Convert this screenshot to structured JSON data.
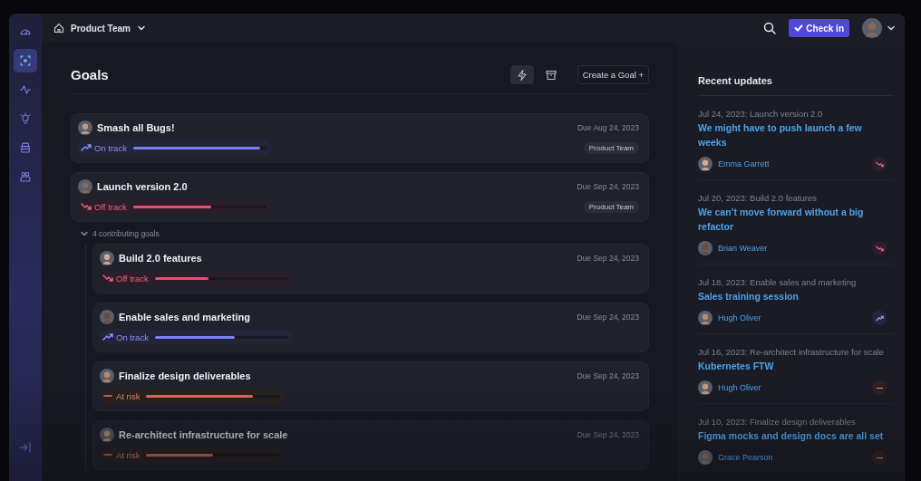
{
  "topbar": {
    "team": "Product Team",
    "check_in": "Check in"
  },
  "sidebar": {
    "items": [
      {
        "selected": false
      },
      {
        "selected": true
      },
      {
        "selected": false
      },
      {
        "selected": false
      },
      {
        "selected": false
      },
      {
        "selected": false
      }
    ]
  },
  "goals": {
    "title": "Goals",
    "view_buttons": [
      {
        "selected": true
      },
      {
        "selected": false
      }
    ],
    "create_button": "Create a Goal +",
    "items": [
      {
        "title": "Smash all Bugs!",
        "status": {
          "kind": "on_track",
          "label": "On track",
          "level": 0.95
        },
        "due": "Due Aug 24, 2023",
        "tag": "Product Team"
      },
      {
        "title": "Launch version 2.0",
        "status": {
          "kind": "off_track",
          "label": "Off track",
          "level": 0.59
        },
        "due": "Due Sep 24, 2023",
        "tag": "Product Team",
        "contributing": {
          "label": "4 contributing goals",
          "expanded": true
        },
        "children": [
          {
            "title": "Build 2.0 features",
            "status": {
              "kind": "off_track",
              "label": "Off track",
              "level": 0.4
            },
            "due": "Due Sep 24, 2023"
          },
          {
            "title": "Enable sales and marketing",
            "status": {
              "kind": "on_track",
              "label": "On track",
              "level": 0.6
            },
            "due": "Due Sep 24, 2023"
          },
          {
            "title": "Finalize design deliverables",
            "status": {
              "kind": "at_risk",
              "label": "At risk",
              "level": 0.8
            },
            "due": "Due Sep 24, 2023"
          },
          {
            "title": "Re-architect infrastructure for scale",
            "status": {
              "kind": "at_risk",
              "label": "At risk",
              "level": 0.5
            },
            "due": "Due Sep 24, 2023"
          }
        ]
      }
    ]
  },
  "updates": {
    "title": "Recent updates",
    "items": [
      {
        "context": "Jul 24, 2023: Launch version 2.0",
        "title": "We might have to push launch a few weeks",
        "author": "Emma Garrett",
        "kind": "off_track"
      },
      {
        "context": "Jul 20, 2023: Build 2.0 features",
        "title": "We can’t move forward without a big refactor",
        "author": "Brian Weaver",
        "kind": "off_track"
      },
      {
        "context": "Jul 18, 2023: Enable sales and marketing",
        "title": "Sales training session",
        "author": "Hugh Oliver",
        "kind": "on_track"
      },
      {
        "context": "Jul 16, 2023: Re-architect infrastructure for scale",
        "title": "Kubernetes FTW",
        "author": "Hugh Oliver",
        "kind": "at_risk"
      },
      {
        "context": "Jul 10, 2023: Finalize design deliverables",
        "title": "Figma mocks and design docs are all set",
        "author": "Grace Pearson",
        "kind": "at_risk"
      }
    ]
  }
}
